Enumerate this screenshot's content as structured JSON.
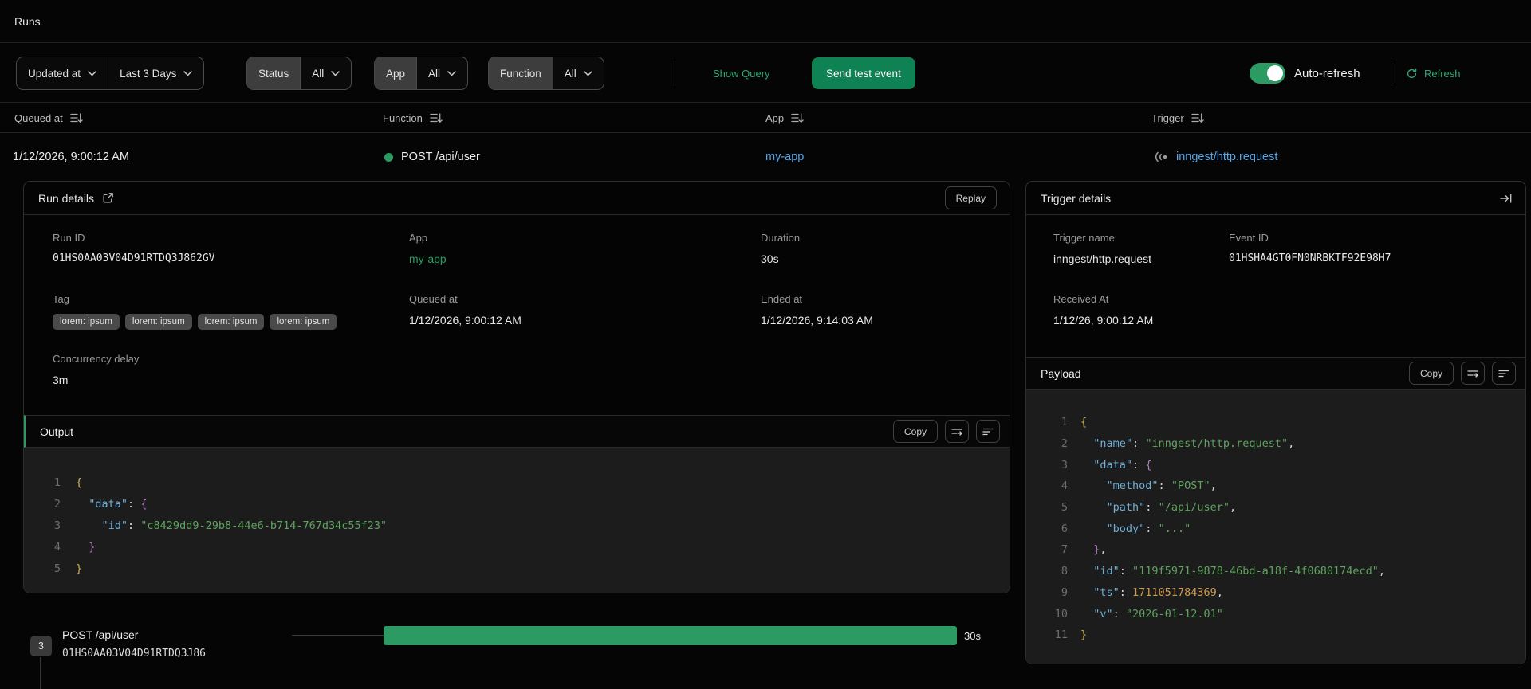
{
  "page": {
    "title": "Runs"
  },
  "colors": {
    "accent_green": "#2C9B63",
    "button_green": "#0E8252",
    "link_blue": "#53A7EA",
    "link_green": "#2EA673",
    "code_key": "#6FB0D8",
    "code_string": "#5EA35E",
    "code_number": "#CE9A52",
    "code_brace_outer": "#C9B458",
    "code_brace_inner": "#AF7EC4"
  },
  "filter_bar": {
    "sort_field": {
      "label": "Updated at"
    },
    "time_range": {
      "label": "Last 3 Days"
    },
    "status_filter": {
      "label": "Status",
      "value": "All"
    },
    "app_filter": {
      "label": "App",
      "value": "All"
    },
    "function_filter": {
      "label": "Function",
      "value": "All"
    },
    "show_query_label": "Show Query",
    "send_test_event_label": "Send test event",
    "auto_refresh_label": "Auto-refresh",
    "refresh_label": "Refresh"
  },
  "runs_table": {
    "columns": [
      {
        "label": "Queued at"
      },
      {
        "label": "Function"
      },
      {
        "label": "App"
      },
      {
        "label": "Trigger"
      }
    ],
    "row": {
      "queued_at": "1/12/2026, 9:00:12 AM",
      "function": "POST /api/user",
      "app": "my-app",
      "trigger": "inngest/http.request"
    }
  },
  "run_details": {
    "title": "Run details",
    "replay_label": "Replay",
    "run_id_label": "Run ID",
    "run_id": "01HS0AA03V04D91RTDQ3J862GV",
    "app_label": "App",
    "app": "my-app",
    "duration_label": "Duration",
    "duration": "30s",
    "tag_label": "Tag",
    "tags": [
      "lorem: ipsum",
      "lorem: ipsum",
      "lorem: ipsum",
      "lorem: ipsum"
    ],
    "queued_at_label": "Queued at",
    "queued_at": "1/12/2026, 9:00:12 AM",
    "ended_at_label": "Ended at",
    "ended_at": "1/12/2026, 9:14:03 AM",
    "concurrency_delay_label": "Concurrency delay",
    "concurrency_delay": "3m"
  },
  "output": {
    "title": "Output",
    "copy_label": "Copy",
    "code": [
      {
        "tokens": [
          [
            "b1",
            "{"
          ]
        ]
      },
      {
        "tokens": [
          [
            "ws",
            "  "
          ],
          [
            "key",
            "\"data\""
          ],
          [
            "pn",
            ": "
          ],
          [
            "b2",
            "{"
          ]
        ]
      },
      {
        "tokens": [
          [
            "ws",
            "    "
          ],
          [
            "key",
            "\"id\""
          ],
          [
            "pn",
            ": "
          ],
          [
            "str",
            "\"c8429dd9-29b8-44e6-b714-767d34c55f23\""
          ]
        ]
      },
      {
        "tokens": [
          [
            "ws",
            "  "
          ],
          [
            "b2",
            "}"
          ]
        ]
      },
      {
        "tokens": [
          [
            "b1",
            "}"
          ]
        ]
      }
    ]
  },
  "trigger_details": {
    "title": "Trigger details",
    "trigger_name_label": "Trigger name",
    "trigger_name": "inngest/http.request",
    "event_id_label": "Event ID",
    "event_id": "01HSHA4GT0FN0NRBKTF92E98H7",
    "received_at_label": "Received At",
    "received_at": "1/12/26, 9:00:12 AM"
  },
  "payload": {
    "title": "Payload",
    "copy_label": "Copy",
    "code": [
      {
        "tokens": [
          [
            "b1",
            "{"
          ]
        ]
      },
      {
        "tokens": [
          [
            "ws",
            "  "
          ],
          [
            "key",
            "\"name\""
          ],
          [
            "pn",
            ": "
          ],
          [
            "str",
            "\"inngest/http.request\""
          ],
          [
            "pn",
            ","
          ]
        ]
      },
      {
        "tokens": [
          [
            "ws",
            "  "
          ],
          [
            "key",
            "\"data\""
          ],
          [
            "pn",
            ": "
          ],
          [
            "b2",
            "{"
          ]
        ]
      },
      {
        "tokens": [
          [
            "ws",
            "    "
          ],
          [
            "key",
            "\"method\""
          ],
          [
            "pn",
            ": "
          ],
          [
            "str",
            "\"POST\""
          ],
          [
            "pn",
            ","
          ]
        ]
      },
      {
        "tokens": [
          [
            "ws",
            "    "
          ],
          [
            "key",
            "\"path\""
          ],
          [
            "pn",
            ": "
          ],
          [
            "str",
            "\"/api/user\""
          ],
          [
            "pn",
            ","
          ]
        ]
      },
      {
        "tokens": [
          [
            "ws",
            "    "
          ],
          [
            "key",
            "\"body\""
          ],
          [
            "pn",
            ": "
          ],
          [
            "str",
            "\"...\""
          ]
        ]
      },
      {
        "tokens": [
          [
            "ws",
            "  "
          ],
          [
            "b2",
            "}"
          ],
          [
            "pn",
            ","
          ]
        ]
      },
      {
        "tokens": [
          [
            "ws",
            "  "
          ],
          [
            "key",
            "\"id\""
          ],
          [
            "pn",
            ": "
          ],
          [
            "str",
            "\"119f5971-9878-46bd-a18f-4f0680174ecd\""
          ],
          [
            "pn",
            ","
          ]
        ]
      },
      {
        "tokens": [
          [
            "ws",
            "  "
          ],
          [
            "key",
            "\"ts\""
          ],
          [
            "pn",
            ": "
          ],
          [
            "num",
            "1711051784369"
          ],
          [
            "pn",
            ","
          ]
        ]
      },
      {
        "tokens": [
          [
            "ws",
            "  "
          ],
          [
            "key",
            "\"v\""
          ],
          [
            "pn",
            ": "
          ],
          [
            "str",
            "\"2026-01-12.01\""
          ]
        ]
      },
      {
        "tokens": [
          [
            "b1",
            "}"
          ]
        ]
      }
    ]
  },
  "timeline": {
    "step_number": "3",
    "function_name": "POST /api/user",
    "run_id": "01HS0AA03V04D91RTDQ3J86",
    "duration": "30s"
  }
}
